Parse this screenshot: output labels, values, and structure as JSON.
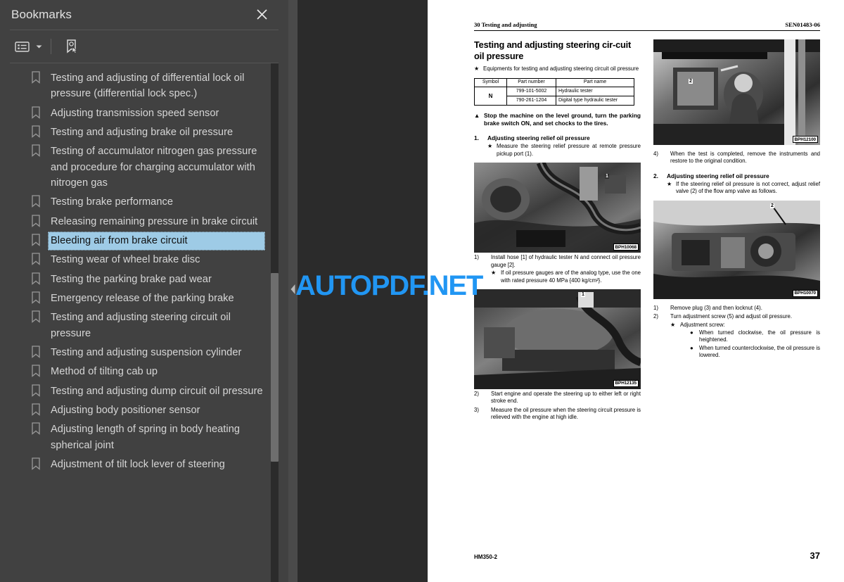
{
  "sidebar": {
    "title": "Bookmarks",
    "close_icon": "close-icon",
    "toolbar": {
      "options_icon": "list-options-icon",
      "caret_icon": "chevron-down-icon",
      "new_bookmark_icon": "new-bookmark-icon"
    },
    "selected_index": 6,
    "items": [
      {
        "label": "Testing and adjusting of differential lock oil pressure (differential lock spec.)"
      },
      {
        "label": "Adjusting transmission speed sensor"
      },
      {
        "label": "Testing and adjusting brake oil pressure"
      },
      {
        "label": "Testing of accumulator nitrogen gas pressure and procedure for charging accumulator with nitrogen gas"
      },
      {
        "label": "Testing brake performance"
      },
      {
        "label": "Releasing remaining pressure in brake circuit"
      },
      {
        "label": "Bleeding air from brake circuit"
      },
      {
        "label": "Testing wear of wheel brake disc"
      },
      {
        "label": "Testing the parking brake pad wear"
      },
      {
        "label": "Emergency release of the parking brake"
      },
      {
        "label": "Testing and adjusting steering circuit oil pressure"
      },
      {
        "label": "Testing and adjusting suspension cylinder"
      },
      {
        "label": "Method of tilting cab up"
      },
      {
        "label": "Testing and adjusting dump circuit oil pressure"
      },
      {
        "label": "Adjusting body positioner sensor"
      },
      {
        "label": "Adjusting length of spring in body heating spherical joint"
      },
      {
        "label": "Adjustment of tilt lock lever of steering"
      }
    ]
  },
  "viewer": {
    "collapse_arrow_icon": "collapse-panel-arrow-icon",
    "watermark": "AUTOPDF.NET",
    "watermark_color": "#2196f3"
  },
  "page": {
    "header_left": "30 Testing and adjusting",
    "header_right": "SEN01483-06",
    "footer_model": "HM350-2",
    "footer_page": "37",
    "left_column": {
      "section_title": "Testing and adjusting steering cir-cuit oil pressure",
      "intro_star": "Equipments for testing and adjusting steering circuit oil pressure",
      "parts_table": {
        "headers": [
          "Symbol",
          "Part number",
          "Part name"
        ],
        "symbol": "N",
        "rows": [
          {
            "part_number": "799-101-5002",
            "part_name": "Hydraulic tester"
          },
          {
            "part_number": "790-261-1204",
            "part_name": "Digital type hydraulic tester"
          }
        ]
      },
      "warning": "Stop the machine on the level ground, turn the parking brake switch ON, and set chocks to the tires.",
      "item1_number": "1.",
      "item1_title": "Adjusting steering relief oil pressure",
      "item1_star": "Measure the steering relief pressure at remote pressure pickup port (1).",
      "photo1_code": "BPH10068",
      "photo1_callout": "1",
      "step1_num": "1)",
      "step1_text": "Install hose [1] of hydraulic tester N and connect oil pressure gauge [2].",
      "step1_star": "If oil pressure gauges are of the analog type, use the one with rated pressure 40 MPa {400 kg/cm²}.",
      "photo2_code": "BPH12135",
      "photo2_callout": "1",
      "step2_num": "2)",
      "step2_text": "Start engine and operate the steering up to either left or right stroke end.",
      "step3_num": "3)",
      "step3_text": "Measure the oil pressure when the steering circuit pressure is relieved with the engine at high idle."
    },
    "right_column": {
      "photo3_code": "BPH12100",
      "photo3_callout": "2",
      "step4_num": "4)",
      "step4_text": "When the test is completed, remove the instruments and restore to the original condition.",
      "item2_number": "2.",
      "item2_title": "Adjusting steering relief oil pressure",
      "item2_star": "If the steering relief oil pressure is not correct, adjust relief valve (2) of the flow amp valve as follows.",
      "photo4_code": "BPH10070",
      "photo4_callout": "2",
      "rstep1_num": "1)",
      "rstep1_text": "Remove plug (3) and then locknut (4).",
      "rstep2_num": "2)",
      "rstep2_text": "Turn adjustment screw (5) and adjust oil pressure.",
      "rstep2_star": "Adjustment screw:",
      "bullet1": "When turned clockwise, the oil pressure is heightened.",
      "bullet2": "When turned counterclockwise, the oil pressure is lowered."
    }
  }
}
